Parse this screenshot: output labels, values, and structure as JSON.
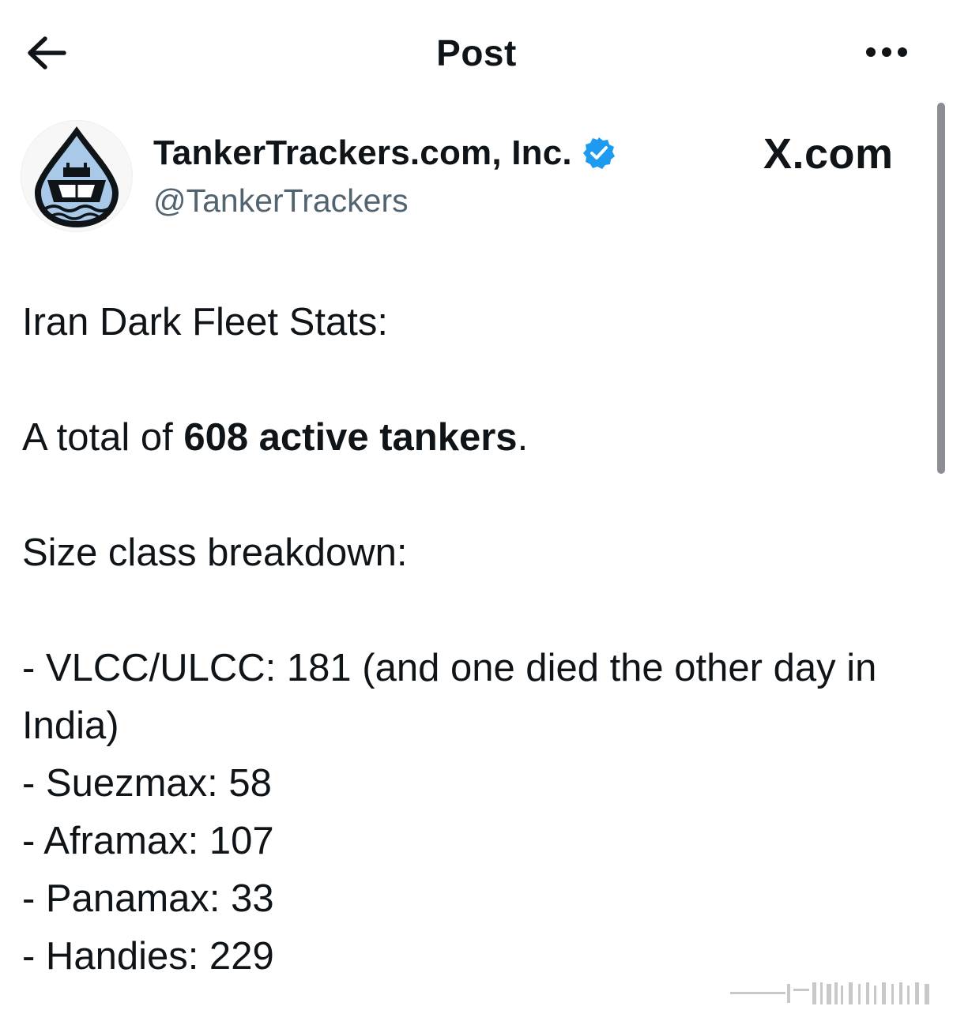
{
  "header": {
    "title": "Post",
    "back_icon": "arrow-left-icon",
    "more_icon": "more-horizontal-icon"
  },
  "author": {
    "display_name": "TankerTrackers.com, Inc.",
    "handle": "@TankerTrackers",
    "verified": true,
    "avatar_icon": "tanker-droplet-logo"
  },
  "source": {
    "brand": "X.com"
  },
  "post": {
    "line1": "Iran Dark Fleet Stats:",
    "line2_prefix": "A total of ",
    "line2_bold": "608 active tankers",
    "line2_suffix": ".",
    "line3": "Size class breakdown:",
    "items": [
      "- VLCC/ULCC: 181 (and one died the other day in India)",
      "- Suezmax: 58",
      "- Aframax: 107",
      "- Panamax: 33",
      "- Handies: 229"
    ]
  },
  "colors": {
    "text": "#0f1419",
    "secondary": "#536471",
    "verified": "#1d9bf0",
    "background": "#ffffff",
    "logo_water": "#a9c9e8"
  }
}
